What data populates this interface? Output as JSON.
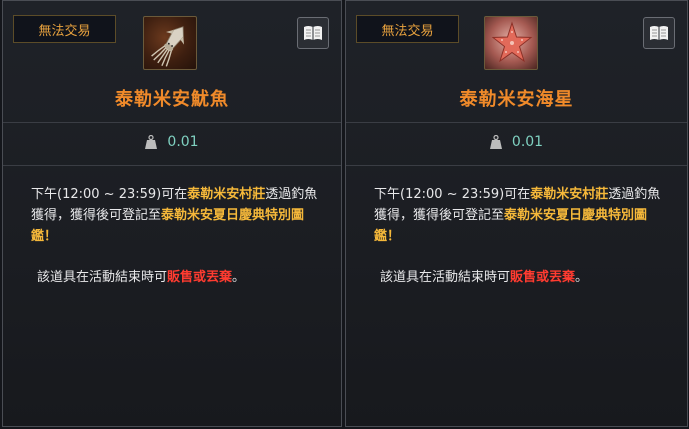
{
  "cards": [
    {
      "trade_label": "無法交易",
      "item_name": "泰勒米安魷魚",
      "icon": "squid-icon",
      "weight": "0.01",
      "desc": {
        "p1": "下午(12:00 ~ 23:59)可在",
        "hl1": "泰勒米安村莊",
        "p2": "透過釣魚獲得，獲得後可登記至",
        "hl2": "泰勒米安夏日慶典特別圖鑑",
        "p3": "！"
      },
      "notice": {
        "p1": "該道具在活動結束時可",
        "red": "販售或丟棄",
        "p2": "。"
      }
    },
    {
      "trade_label": "無法交易",
      "item_name": "泰勒米安海星",
      "icon": "starfish-icon",
      "weight": "0.01",
      "desc": {
        "p1": "下午(12:00 ~ 23:59)可在",
        "hl1": "泰勒米安村莊",
        "p2": "透過釣魚獲得，獲得後可登記至",
        "hl2": "泰勒米安夏日慶典特別圖鑑",
        "p3": "！"
      },
      "notice": {
        "p1": "該道具在活動結束時可",
        "red": "販售或丟棄",
        "p2": "。"
      }
    }
  ],
  "colors": {
    "item_name": "#f08a2a",
    "highlight": "#f5b83a",
    "warning": "#ff3b30",
    "weight": "#7fd0c0"
  }
}
